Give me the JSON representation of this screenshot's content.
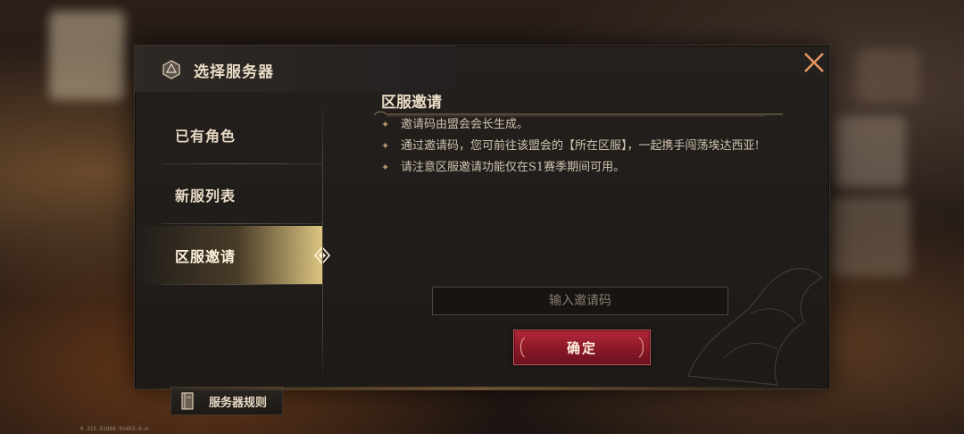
{
  "dialog": {
    "title": "选择服务器",
    "tabs": [
      {
        "label": "已有角色",
        "active": false
      },
      {
        "label": "新服列表",
        "active": false
      },
      {
        "label": "区服邀请",
        "active": true
      }
    ],
    "rules_button": "服务器规则"
  },
  "invite": {
    "heading": "区服邀请",
    "bullets": [
      "邀请码由盟会会长生成。",
      "通过邀请码，您可前往该盟会的【所在区服】，一起携手闯荡埃达西亚!",
      "请注意区服邀请功能仅在S1赛季期间可用。"
    ],
    "input_placeholder": "输入邀请码",
    "confirm_label": "确定"
  },
  "build_text": "0.315.81968-91453-0-m",
  "icons": [
    "dice-icon",
    "close-icon",
    "arrow-diamond-icon",
    "book-icon",
    "bullet-star-icon"
  ],
  "colors": {
    "accent_red": "#8a1826",
    "gold": "#b59a6d",
    "text": "#e9dcc6"
  }
}
